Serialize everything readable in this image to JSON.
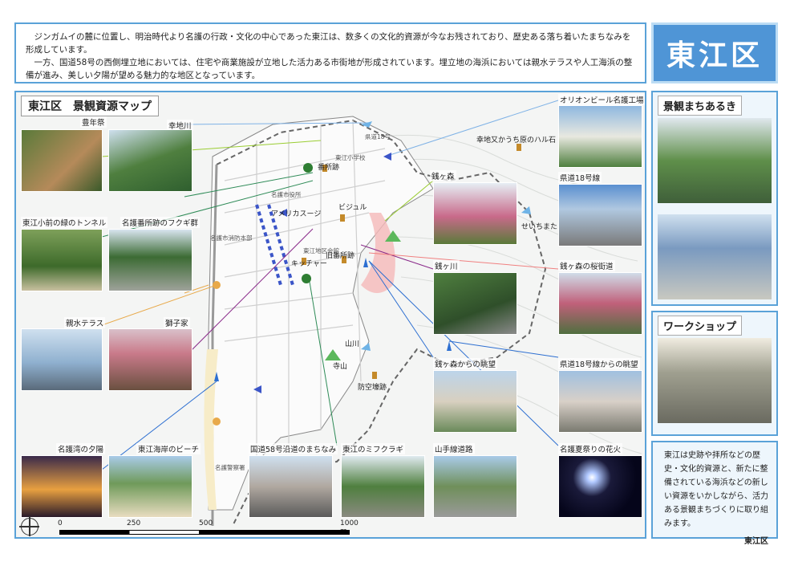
{
  "intro": {
    "p1": "ジンガムイの麓に位置し、明治時代より名護の行政・文化の中心であった東江は、数多くの文化的資源が今なお残されており、歴史ある落ち着いたまちなみを形成しています。",
    "p2": "一方、国道58号の西側埋立地においては、住宅や商業施設が立地した活力ある市街地が形成されています。埋立地の海浜においては親水テラスや人工海浜の整備が進み、美しい夕陽が望める魅力的な地区となっています。"
  },
  "district_title": "東江区",
  "map": {
    "title": "東江区　景観資源マップ",
    "photo_labels": {
      "hounensai": "豊年祭",
      "sachijigawa": "幸地川",
      "orion": "オリオンビール名護工場",
      "kodo18": "県道18号線",
      "tunnel": "東江小前の緑のトンネル",
      "fukugi": "名護番所跡のフクギ群",
      "zenimori": "銭ヶ森",
      "sakura": "銭ヶ森の桜街道",
      "shinsui": "親水テラス",
      "shishiya": "獅子家",
      "zenigawa": "銭ヶ川",
      "zenimori_view": "銭ヶ森からの眺望",
      "kodo18_view": "県道18号線からの眺望",
      "yuhi": "名護湾の夕陽",
      "beach": "東江海岸のビーチ",
      "route58": "国道58号沿道のまちなみ",
      "mifukuragi": "東江のミフクラギ",
      "yamate": "山手線道路",
      "hanabi": "名護夏祭りの花火"
    },
    "place_labels": {
      "bansho": "番所跡",
      "american": "アメリカスージ",
      "bijuru": "ビジュル",
      "kyucha": "キッチャー",
      "kyubansho": "旧番所跡",
      "yamagawa": "山川",
      "terayama": "寺山",
      "bokugo": "防空壕跡",
      "seichimata": "せいちまた",
      "haruishi": "幸地又かうち原のハル石",
      "kodo18_small": "県道18号",
      "elementary": "東江小学校",
      "nago_yakuba": "名護市役所",
      "nago_central": "名護市消防本部",
      "community": "東江地区会館",
      "nago_police": "名護警察署"
    },
    "scale": {
      "s0": "0",
      "s250": "250",
      "s500": "500",
      "s1000": "1000 m"
    }
  },
  "sidebar": {
    "machi_title": "景観まちあるき",
    "workshop_title": "ワークショップ",
    "summary": "東江は史跡や拝所などの歴史・文化的資源と、新たに整備されている海浜などの新しい資源をいかしながら、活力ある景観まちづくりに取り組みます。",
    "sign": "東江区"
  }
}
